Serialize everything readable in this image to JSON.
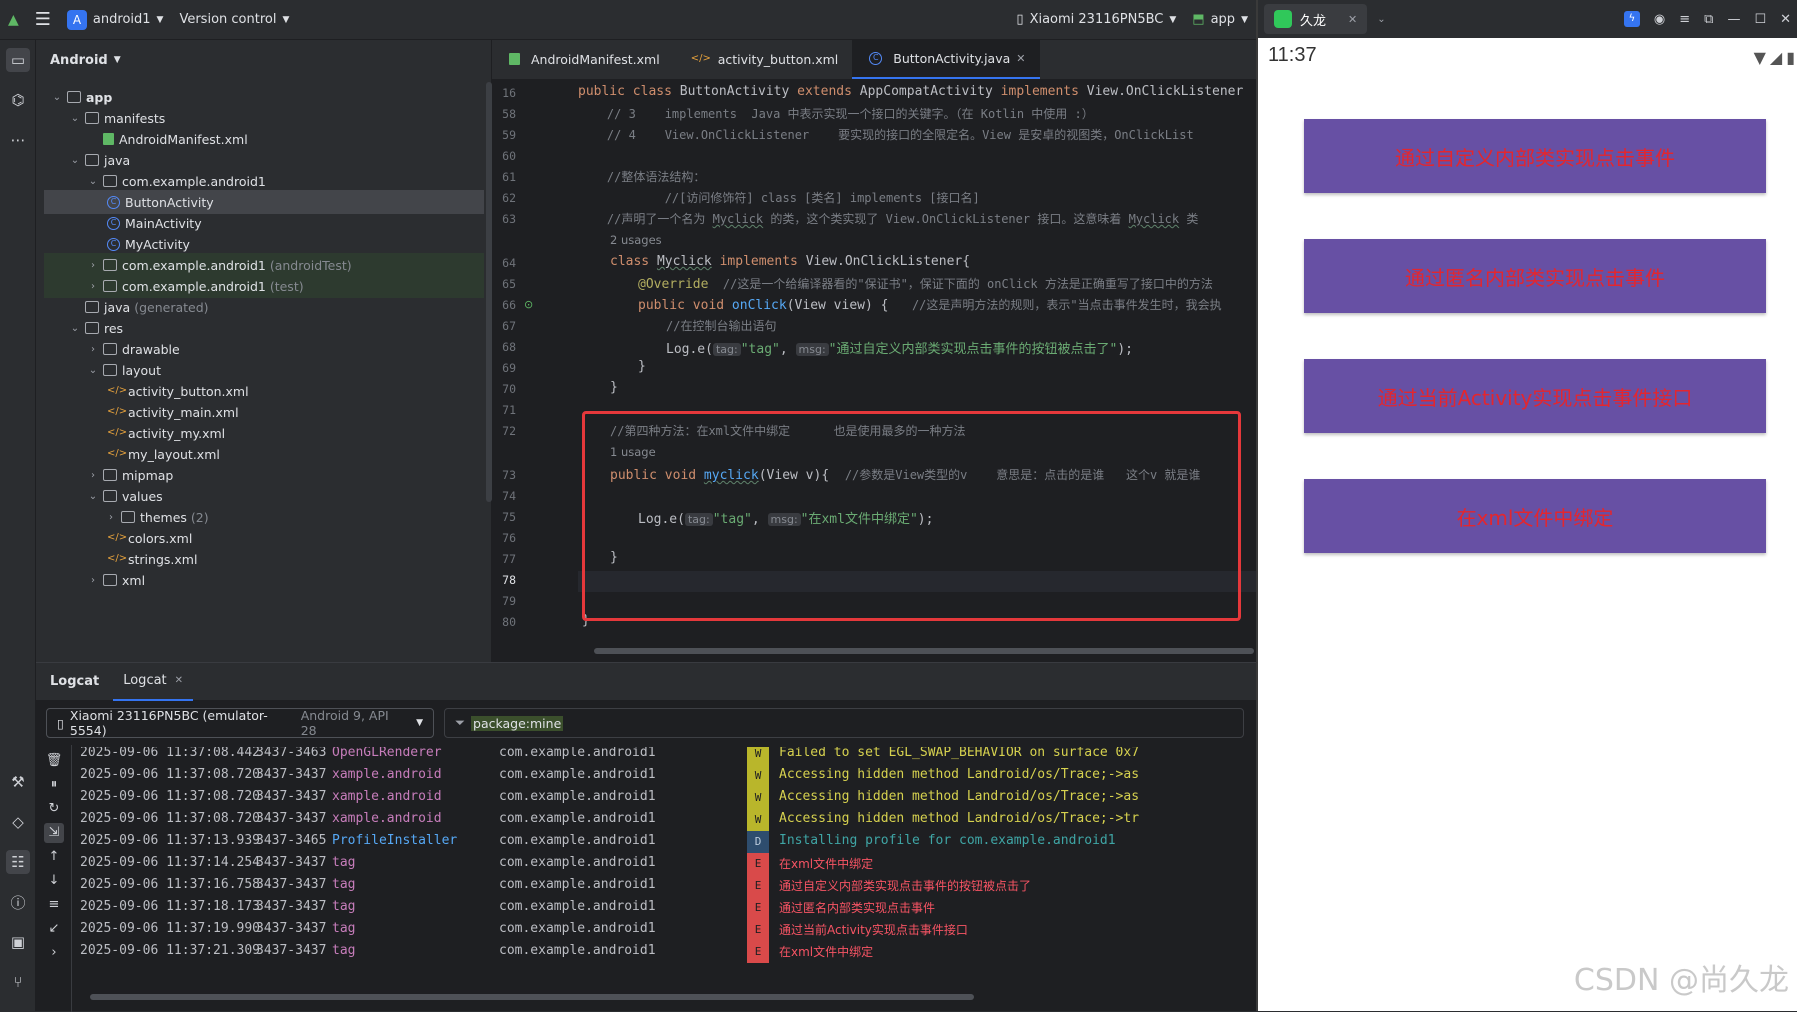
{
  "titlebar": {
    "project_badge": "A",
    "project_name": "android1",
    "vcs": "Version control",
    "device": "Xiaomi 23116PN5BC",
    "run_config": "app"
  },
  "project_panel": {
    "view_mode": "Android",
    "items": [
      {
        "label": "app",
        "dim": ""
      },
      {
        "label": "manifests",
        "dim": ""
      },
      {
        "label": "AndroidManifest.xml",
        "dim": ""
      },
      {
        "label": "java",
        "dim": ""
      },
      {
        "label": "com.example.android1",
        "dim": ""
      },
      {
        "label": "ButtonActivity",
        "dim": ""
      },
      {
        "label": "MainActivity",
        "dim": ""
      },
      {
        "label": "MyActivity",
        "dim": ""
      },
      {
        "label": "com.example.android1",
        "dim": "(androidTest)"
      },
      {
        "label": "com.example.android1",
        "dim": "(test)"
      },
      {
        "label": "java",
        "dim": "(generated)"
      },
      {
        "label": "res",
        "dim": ""
      },
      {
        "label": "drawable",
        "dim": ""
      },
      {
        "label": "layout",
        "dim": ""
      },
      {
        "label": "activity_button.xml",
        "dim": ""
      },
      {
        "label": "activity_main.xml",
        "dim": ""
      },
      {
        "label": "activity_my.xml",
        "dim": ""
      },
      {
        "label": "my_layout.xml",
        "dim": ""
      },
      {
        "label": "mipmap",
        "dim": ""
      },
      {
        "label": "values",
        "dim": ""
      },
      {
        "label": "themes",
        "dim": "(2)"
      },
      {
        "label": "colors.xml",
        "dim": ""
      },
      {
        "label": "strings.xml",
        "dim": ""
      },
      {
        "label": "xml",
        "dim": ""
      }
    ]
  },
  "editor": {
    "tabs": [
      {
        "label": "AndroidManifest.xml"
      },
      {
        "label": "activity_button.xml"
      },
      {
        "label": "ButtonActivity.java"
      }
    ],
    "line_numbers": [
      "16",
      "58",
      "59",
      "60",
      "61",
      "62",
      "63",
      "",
      "64",
      "65",
      "66",
      "67",
      "68",
      "69",
      "70",
      "71",
      "72",
      "",
      "73",
      "74",
      "75",
      "76",
      "77",
      "78",
      "79",
      "80"
    ],
    "code": {
      "l16": {
        "a": "public class ",
        "b": "ButtonActivity ",
        "c": "extends ",
        "d": "AppCompatActivity ",
        "e": "implements ",
        "f": "View.OnClickListener"
      },
      "l58": "    // 3    implements  Java 中表示实现一个接口的关键字。（在 Kotlin 中使用 :）",
      "l59": "    // 4    View.OnClickListener    要实现的接口的全限定名。View 是安卓的视图类，OnClickList",
      "l61": "    //整体语法结构：",
      "l62": "            //[访问修饰符] class [类名] implements [接口名]",
      "l63a": "    //声明了一个名为 ",
      "l63b": "Myclick",
      "l63c": " 的类，这个类实现了 View.OnClickListener 接口。这意味着 ",
      "l63d": "Myclick",
      "l63e": " 类",
      "usage2": "2 usages",
      "l64a": "class ",
      "l64b": "Myclick",
      "l64c": " implements ",
      "l64d": "View.OnClickListener{",
      "l65a": "@Override",
      "l65b": "  //这是一个给编译器看的\"保证书\"，保证下面的 onClick 方法是正确重写了接口中的方法",
      "l66a": "public void ",
      "l66b": "onClick",
      "l66c": "(View view) {   ",
      "l66d": "//这是声明方法的规则，表示\"当点击事件发生时，我会执",
      "l67": "//在控制台输出语句",
      "l68a": "Log.e(",
      "l68tag": "tag:",
      "l68b": "\"tag\"",
      "l68c": ", ",
      "l68msg": "msg:",
      "l68d": "\"通过自定义内部类实现点击事件的按钮被点击了\"",
      "l68e": ");",
      "l69": "}",
      "l70": "}",
      "l72": "//第四种方法：在xml文件中绑定      也是使用最多的一种方法",
      "usage1": "1 usage",
      "l73a": "public void ",
      "l73b": "myclick",
      "l73c": "(View v){  ",
      "l73d": "//参数是View类型的v    意思是：点击的是谁   这个v 就是谁",
      "l75a": "Log.e(",
      "l75tag": "tag:",
      "l75b": "\"tag\"",
      "l75c": ", ",
      "l75msg": "msg:",
      "l75d": "\"在xml文件中绑定\"",
      "l75e": ");",
      "l77": "}",
      "l80": "}"
    }
  },
  "logcat": {
    "tabs": [
      "Logcat",
      "Logcat"
    ],
    "device_selector": "Xiaomi 23116PN5BC (emulator-5554)",
    "device_api": "Android 9, API 28",
    "filter": "package:mine",
    "rows": [
      {
        "time": "2025-09-06 11:37:08.442",
        "pid": "3437-3463",
        "tag": "OpenGLRenderer",
        "pkg": "com.example.android1",
        "level": "W",
        "msg": "Failed to set EGL_SWAP_BEHAVIOR on surface 0x7"
      },
      {
        "time": "2025-09-06 11:37:08.720",
        "pid": "3437-3437",
        "tag": "xample.android",
        "pkg": "com.example.android1",
        "level": "W",
        "msg": "Accessing hidden method Landroid/os/Trace;->as"
      },
      {
        "time": "2025-09-06 11:37:08.720",
        "pid": "3437-3437",
        "tag": "xample.android",
        "pkg": "com.example.android1",
        "level": "W",
        "msg": "Accessing hidden method Landroid/os/Trace;->as"
      },
      {
        "time": "2025-09-06 11:37:08.720",
        "pid": "3437-3437",
        "tag": "xample.android",
        "pkg": "com.example.android1",
        "level": "W",
        "msg": "Accessing hidden method Landroid/os/Trace;->tr"
      },
      {
        "time": "2025-09-06 11:37:13.939",
        "pid": "3437-3465",
        "tag": "ProfileInstaller",
        "pkg": "com.example.android1",
        "level": "D",
        "msg": "Installing profile for com.example.android1"
      },
      {
        "time": "2025-09-06 11:37:14.254",
        "pid": "3437-3437",
        "tag": "tag",
        "pkg": "com.example.android1",
        "level": "E",
        "msg": "在xml文件中绑定"
      },
      {
        "time": "2025-09-06 11:37:16.758",
        "pid": "3437-3437",
        "tag": "tag",
        "pkg": "com.example.android1",
        "level": "E",
        "msg": "通过自定义内部类实现点击事件的按钮被点击了"
      },
      {
        "time": "2025-09-06 11:37:18.173",
        "pid": "3437-3437",
        "tag": "tag",
        "pkg": "com.example.android1",
        "level": "E",
        "msg": "通过匿名内部类实现点击事件"
      },
      {
        "time": "2025-09-06 11:37:19.990",
        "pid": "3437-3437",
        "tag": "tag",
        "pkg": "com.example.android1",
        "level": "E",
        "msg": "通过当前Activity实现点击事件接口"
      },
      {
        "time": "2025-09-06 11:37:21.309",
        "pid": "3437-3437",
        "tag": "tag",
        "pkg": "com.example.android1",
        "level": "E",
        "msg": "在xml文件中绑定"
      }
    ]
  },
  "emulator": {
    "window_title": "久龙",
    "clock": "11:37",
    "buttons": [
      "通过自定义内部类实现点击事件",
      "通过匿名内部类实现点击事件",
      "通过当前Activity实现点击事件接口",
      "在xml文件中绑定"
    ],
    "watermark": "CSDN @尚久龙"
  },
  "colors": {
    "button_bg": "#6750a4",
    "button_text": "#e3262f",
    "highlight_box": "#e5383b"
  }
}
